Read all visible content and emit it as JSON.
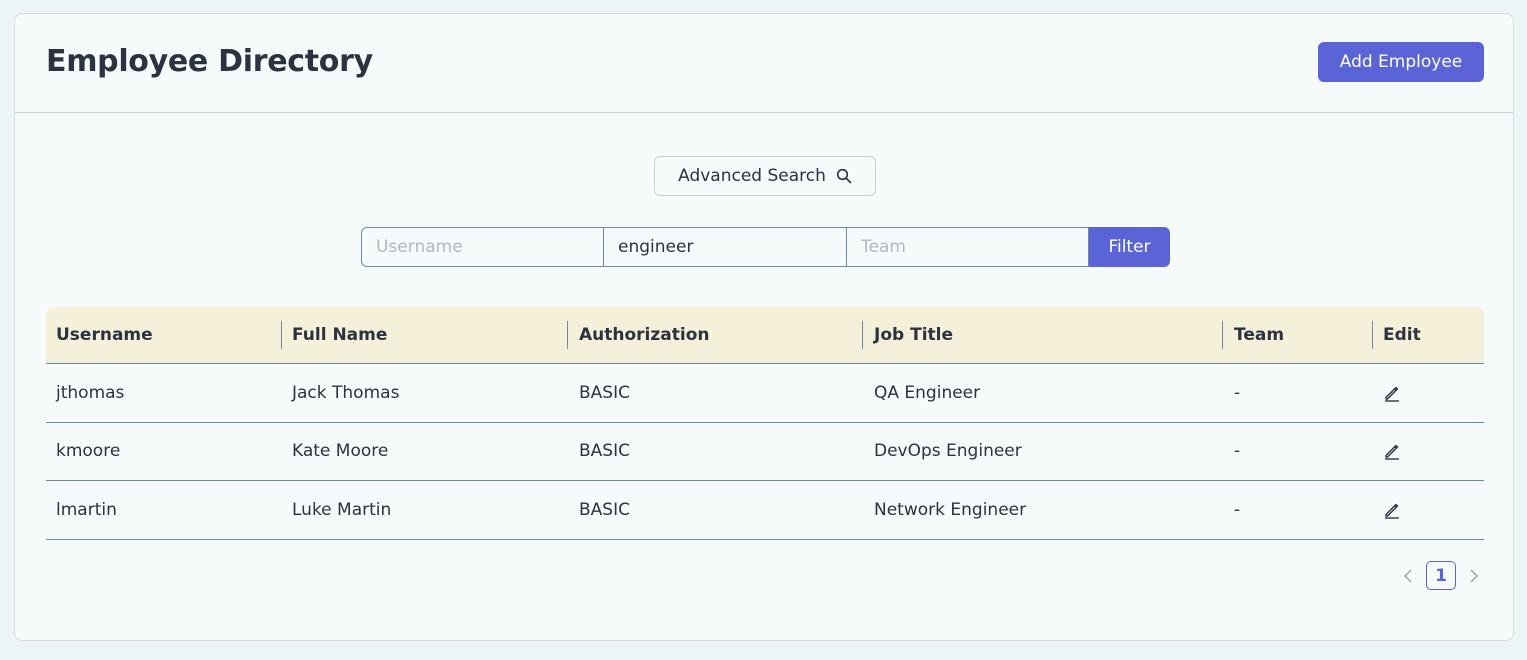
{
  "header": {
    "title": "Employee Directory",
    "add_button_label": "Add Employee"
  },
  "search": {
    "advanced_label": "Advanced Search",
    "icon": "search-icon",
    "username_placeholder": "Username",
    "username_value": "",
    "job_title_value": "engineer",
    "team_placeholder": "Team",
    "team_value": "",
    "filter_label": "Filter"
  },
  "table": {
    "columns": [
      "Username",
      "Full Name",
      "Authorization",
      "Job Title",
      "Team",
      "Edit"
    ],
    "rows": [
      {
        "username": "jthomas",
        "full_name": "Jack Thomas",
        "authorization": "BASIC",
        "job_title": "QA Engineer",
        "team": "-",
        "edit_icon": "pencil-icon"
      },
      {
        "username": "kmoore",
        "full_name": "Kate Moore",
        "authorization": "BASIC",
        "job_title": "DevOps Engineer",
        "team": "-",
        "edit_icon": "pencil-icon"
      },
      {
        "username": "lmartin",
        "full_name": "Luke Martin",
        "authorization": "BASIC",
        "job_title": "Network Engineer",
        "team": "-",
        "edit_icon": "pencil-icon"
      }
    ]
  },
  "pagination": {
    "current_page": "1",
    "prev_icon": "chevron-left-icon",
    "next_icon": "chevron-right-icon"
  },
  "colors": {
    "accent": "#5b64d6",
    "header_bg": "#f5f0d9",
    "page_bg": "#ecf4f5",
    "card_bg": "#f6fafb"
  }
}
